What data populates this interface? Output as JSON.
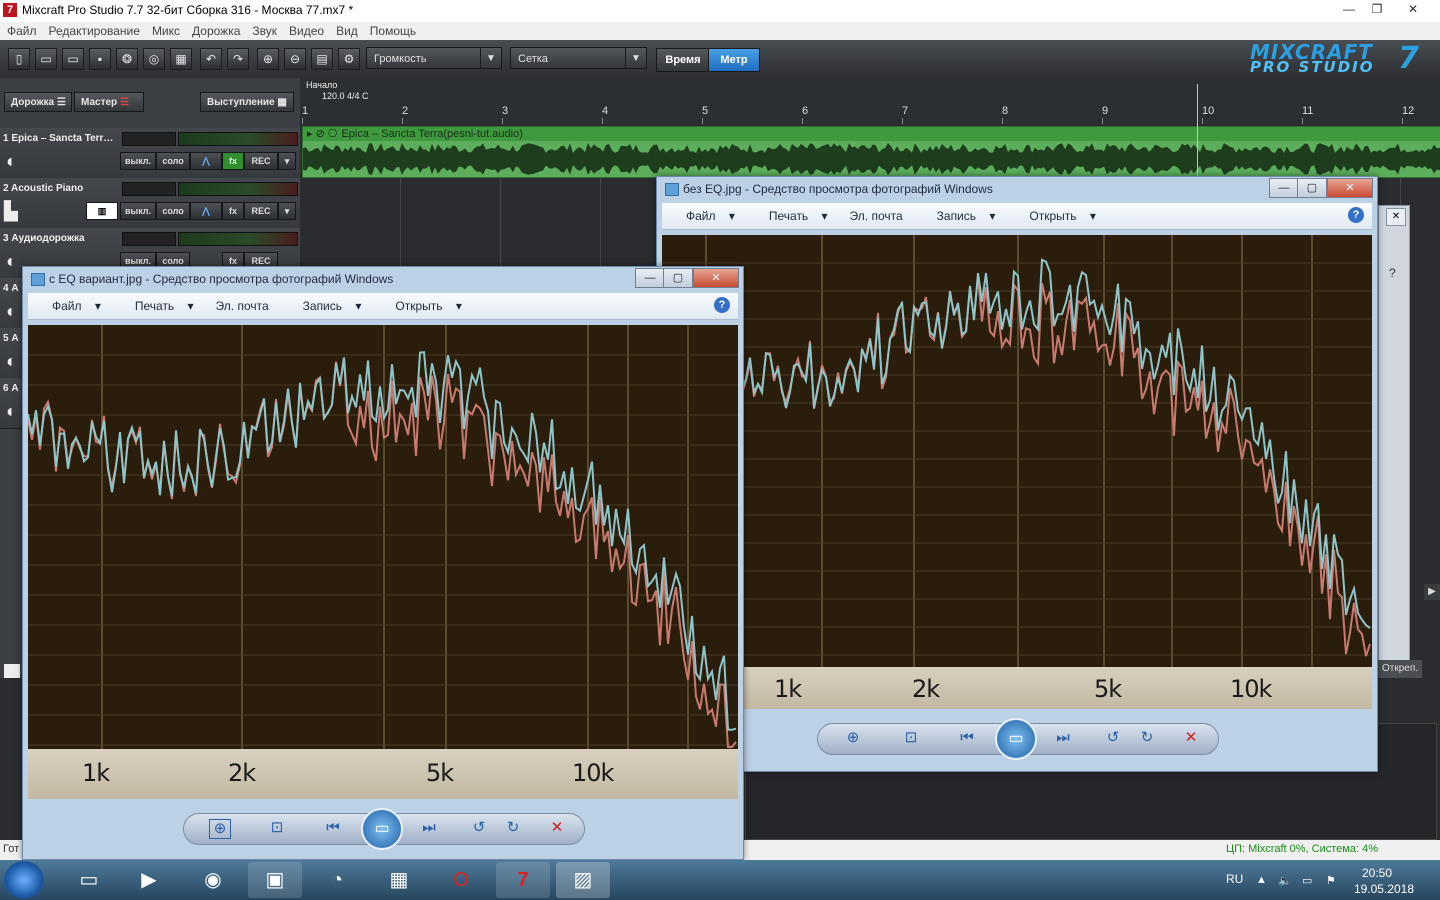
{
  "mixcraft": {
    "title": "Mixcraft Pro Studio 7.7 32-бит Сборка 316 - Москва 77.mx7 *",
    "menu": [
      "Файл",
      "Редактирование",
      "Микс",
      "Дорожка",
      "Звук",
      "Видео",
      "Вид",
      "Помощь"
    ],
    "toolbar": {
      "volume_select": "Громкость",
      "grid_select": "Сетка",
      "time_toggle": "Время",
      "meter_toggle": "Метр"
    },
    "logo_line1": "MIXCRAFT",
    "logo_line2": "PRO STUDIO",
    "logo_version": "7",
    "panel_buttons": {
      "track": "Дорожка",
      "master": "Мастер",
      "perform": "Выступление"
    },
    "tracks": [
      {
        "name": "1 Epica – Sancta Terr…"
      },
      {
        "name": "2 Acoustic Piano"
      },
      {
        "name": "3 Аудиодорожка"
      },
      {
        "name": "4 А"
      },
      {
        "name": "5 А"
      },
      {
        "name": "6 А"
      }
    ],
    "track_buttons": {
      "off": "выкл.",
      "solo": "соло",
      "fx": "fx",
      "rec": "REC"
    },
    "timeline": {
      "start_label": "Начало",
      "tempo_label": "120.0 4/4 C",
      "measures": [
        "1",
        "2",
        "3",
        "4",
        "5",
        "6",
        "7",
        "8",
        "9",
        "10",
        "11",
        "12"
      ]
    },
    "clip_label": "Epica – Sancta Terra(pesni-tut.audio)",
    "right_peek": {
      "help": "?",
      "detach": "Откреп."
    },
    "status_left": "Гот",
    "status_right": "ЦП: Mixcraft 0%, Система: 4%"
  },
  "viewer_back": {
    "title": "без EQ.jpg - Средство просмотра фотографий Windows",
    "menu": [
      "Файл",
      "Печать",
      "Эл. почта",
      "Запись",
      "Открыть"
    ],
    "axis_labels": [
      "1k",
      "2k",
      "5k",
      "10k"
    ]
  },
  "viewer_front": {
    "title": "с EQ вариант.jpg - Средство просмотра фотографий Windows",
    "menu": [
      "Файл",
      "Печать",
      "Эл. почта",
      "Запись",
      "Открыть"
    ],
    "axis_labels": [
      "1k",
      "2k",
      "5k",
      "10k"
    ]
  },
  "taskbar": {
    "lang": "RU",
    "time": "20:50",
    "date": "19.05.2018"
  },
  "colors": {
    "accent_blue": "#2e7fd0",
    "clip_green": "#5cae5c",
    "spectrum_blue": "#8fc4c8",
    "spectrum_red": "#c97a70"
  }
}
